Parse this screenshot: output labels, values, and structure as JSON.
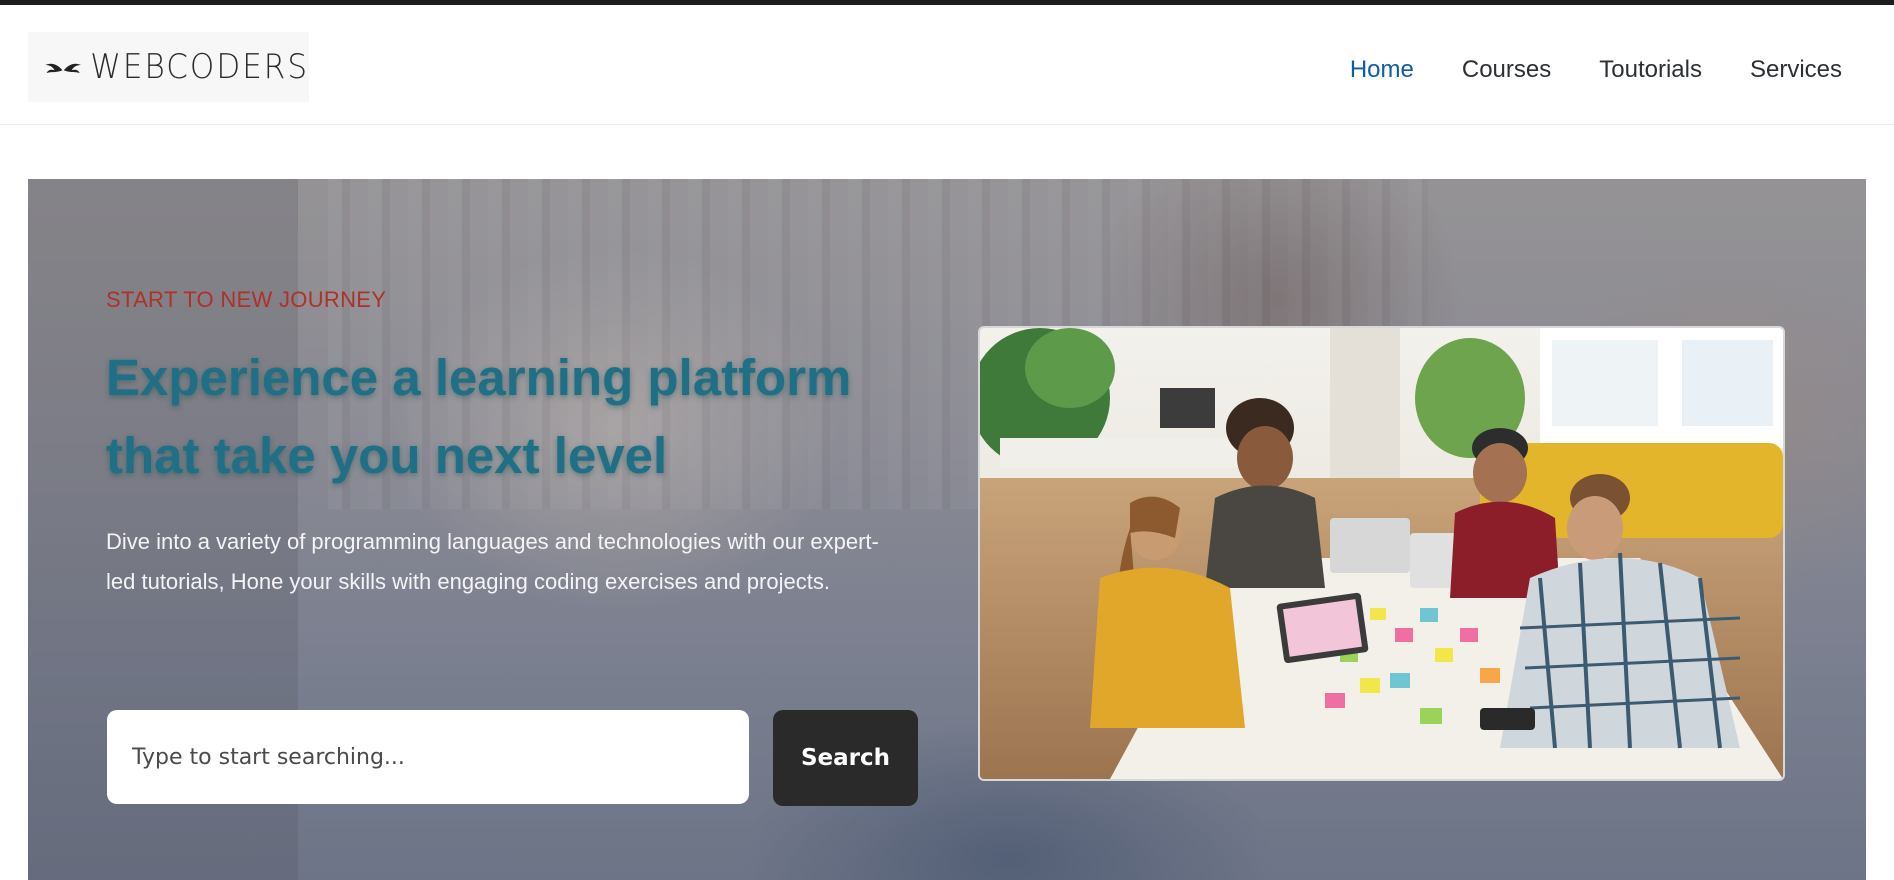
{
  "brand": {
    "logo_text": "WEBCODERS"
  },
  "nav": {
    "items": [
      {
        "label": "Home",
        "active": true
      },
      {
        "label": "Courses",
        "active": false
      },
      {
        "label": "Toutorials",
        "active": false
      },
      {
        "label": "Services",
        "active": false
      }
    ]
  },
  "hero": {
    "eyebrow": "START TO NEW JOURNEY",
    "headline": "Experience a learning platform that take you next level",
    "description": "Dive into a variety of programming languages and technologies with our expert-led tutorials, Hone your skills with engaging coding exercises and projects.",
    "search": {
      "placeholder": "Type to start searching...",
      "value": ""
    },
    "search_button": "Search"
  },
  "colors": {
    "nav_active": "#0d5ca6",
    "eyebrow": "#b0302a",
    "headline": "#1f6f86",
    "button_bg": "#2a2a2a"
  },
  "icons": [
    "wings-logo-icon"
  ]
}
